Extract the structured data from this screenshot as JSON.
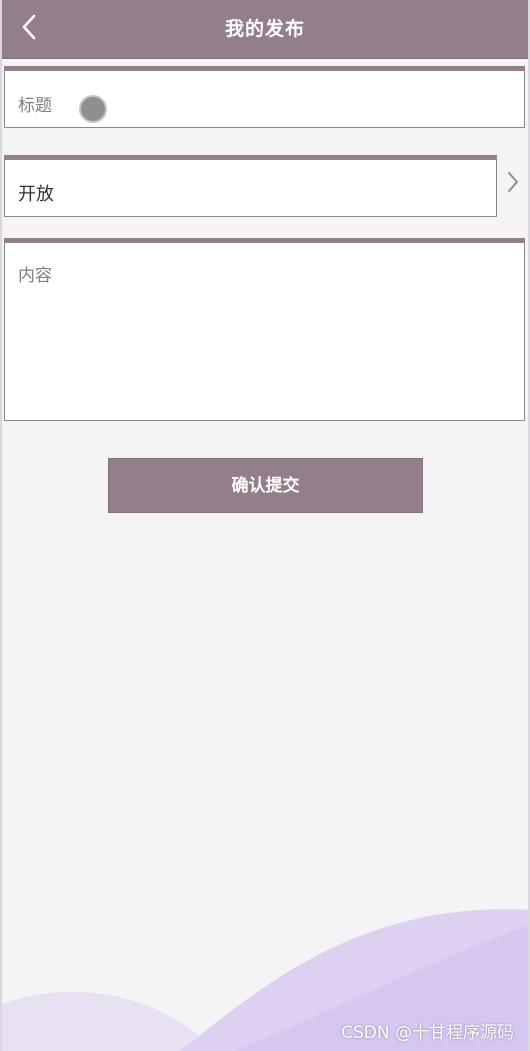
{
  "header": {
    "title": "我的发布",
    "back_icon": "chevron-left-icon"
  },
  "form": {
    "title_placeholder": "标题",
    "status_value": "开放",
    "content_placeholder": "内容",
    "submit_label": "确认提交",
    "chevron_icon": "chevron-right-icon"
  },
  "watermark": "CSDN @十甘程序源码",
  "colors": {
    "accent": "#927f8b",
    "background": "#f4f4f6",
    "wave_light": "#e8e1f1",
    "wave_mid": "#ddd0f1",
    "wave_dark": "#d5c7ef"
  }
}
